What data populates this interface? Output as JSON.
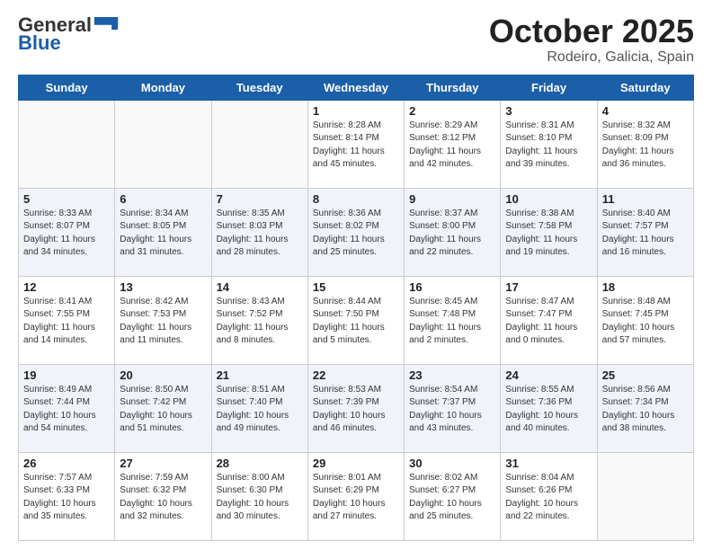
{
  "header": {
    "logo_line1": "General",
    "logo_line2": "Blue",
    "title": "October 2025",
    "subtitle": "Rodeiro, Galicia, Spain"
  },
  "days_of_week": [
    "Sunday",
    "Monday",
    "Tuesday",
    "Wednesday",
    "Thursday",
    "Friday",
    "Saturday"
  ],
  "weeks": [
    [
      {
        "day": "",
        "sunrise": "",
        "sunset": "",
        "daylight": ""
      },
      {
        "day": "",
        "sunrise": "",
        "sunset": "",
        "daylight": ""
      },
      {
        "day": "",
        "sunrise": "",
        "sunset": "",
        "daylight": ""
      },
      {
        "day": "1",
        "sunrise": "Sunrise: 8:28 AM",
        "sunset": "Sunset: 8:14 PM",
        "daylight": "Daylight: 11 hours and 45 minutes."
      },
      {
        "day": "2",
        "sunrise": "Sunrise: 8:29 AM",
        "sunset": "Sunset: 8:12 PM",
        "daylight": "Daylight: 11 hours and 42 minutes."
      },
      {
        "day": "3",
        "sunrise": "Sunrise: 8:31 AM",
        "sunset": "Sunset: 8:10 PM",
        "daylight": "Daylight: 11 hours and 39 minutes."
      },
      {
        "day": "4",
        "sunrise": "Sunrise: 8:32 AM",
        "sunset": "Sunset: 8:09 PM",
        "daylight": "Daylight: 11 hours and 36 minutes."
      }
    ],
    [
      {
        "day": "5",
        "sunrise": "Sunrise: 8:33 AM",
        "sunset": "Sunset: 8:07 PM",
        "daylight": "Daylight: 11 hours and 34 minutes."
      },
      {
        "day": "6",
        "sunrise": "Sunrise: 8:34 AM",
        "sunset": "Sunset: 8:05 PM",
        "daylight": "Daylight: 11 hours and 31 minutes."
      },
      {
        "day": "7",
        "sunrise": "Sunrise: 8:35 AM",
        "sunset": "Sunset: 8:03 PM",
        "daylight": "Daylight: 11 hours and 28 minutes."
      },
      {
        "day": "8",
        "sunrise": "Sunrise: 8:36 AM",
        "sunset": "Sunset: 8:02 PM",
        "daylight": "Daylight: 11 hours and 25 minutes."
      },
      {
        "day": "9",
        "sunrise": "Sunrise: 8:37 AM",
        "sunset": "Sunset: 8:00 PM",
        "daylight": "Daylight: 11 hours and 22 minutes."
      },
      {
        "day": "10",
        "sunrise": "Sunrise: 8:38 AM",
        "sunset": "Sunset: 7:58 PM",
        "daylight": "Daylight: 11 hours and 19 minutes."
      },
      {
        "day": "11",
        "sunrise": "Sunrise: 8:40 AM",
        "sunset": "Sunset: 7:57 PM",
        "daylight": "Daylight: 11 hours and 16 minutes."
      }
    ],
    [
      {
        "day": "12",
        "sunrise": "Sunrise: 8:41 AM",
        "sunset": "Sunset: 7:55 PM",
        "daylight": "Daylight: 11 hours and 14 minutes."
      },
      {
        "day": "13",
        "sunrise": "Sunrise: 8:42 AM",
        "sunset": "Sunset: 7:53 PM",
        "daylight": "Daylight: 11 hours and 11 minutes."
      },
      {
        "day": "14",
        "sunrise": "Sunrise: 8:43 AM",
        "sunset": "Sunset: 7:52 PM",
        "daylight": "Daylight: 11 hours and 8 minutes."
      },
      {
        "day": "15",
        "sunrise": "Sunrise: 8:44 AM",
        "sunset": "Sunset: 7:50 PM",
        "daylight": "Daylight: 11 hours and 5 minutes."
      },
      {
        "day": "16",
        "sunrise": "Sunrise: 8:45 AM",
        "sunset": "Sunset: 7:48 PM",
        "daylight": "Daylight: 11 hours and 2 minutes."
      },
      {
        "day": "17",
        "sunrise": "Sunrise: 8:47 AM",
        "sunset": "Sunset: 7:47 PM",
        "daylight": "Daylight: 11 hours and 0 minutes."
      },
      {
        "day": "18",
        "sunrise": "Sunrise: 8:48 AM",
        "sunset": "Sunset: 7:45 PM",
        "daylight": "Daylight: 10 hours and 57 minutes."
      }
    ],
    [
      {
        "day": "19",
        "sunrise": "Sunrise: 8:49 AM",
        "sunset": "Sunset: 7:44 PM",
        "daylight": "Daylight: 10 hours and 54 minutes."
      },
      {
        "day": "20",
        "sunrise": "Sunrise: 8:50 AM",
        "sunset": "Sunset: 7:42 PM",
        "daylight": "Daylight: 10 hours and 51 minutes."
      },
      {
        "day": "21",
        "sunrise": "Sunrise: 8:51 AM",
        "sunset": "Sunset: 7:40 PM",
        "daylight": "Daylight: 10 hours and 49 minutes."
      },
      {
        "day": "22",
        "sunrise": "Sunrise: 8:53 AM",
        "sunset": "Sunset: 7:39 PM",
        "daylight": "Daylight: 10 hours and 46 minutes."
      },
      {
        "day": "23",
        "sunrise": "Sunrise: 8:54 AM",
        "sunset": "Sunset: 7:37 PM",
        "daylight": "Daylight: 10 hours and 43 minutes."
      },
      {
        "day": "24",
        "sunrise": "Sunrise: 8:55 AM",
        "sunset": "Sunset: 7:36 PM",
        "daylight": "Daylight: 10 hours and 40 minutes."
      },
      {
        "day": "25",
        "sunrise": "Sunrise: 8:56 AM",
        "sunset": "Sunset: 7:34 PM",
        "daylight": "Daylight: 10 hours and 38 minutes."
      }
    ],
    [
      {
        "day": "26",
        "sunrise": "Sunrise: 7:57 AM",
        "sunset": "Sunset: 6:33 PM",
        "daylight": "Daylight: 10 hours and 35 minutes."
      },
      {
        "day": "27",
        "sunrise": "Sunrise: 7:59 AM",
        "sunset": "Sunset: 6:32 PM",
        "daylight": "Daylight: 10 hours and 32 minutes."
      },
      {
        "day": "28",
        "sunrise": "Sunrise: 8:00 AM",
        "sunset": "Sunset: 6:30 PM",
        "daylight": "Daylight: 10 hours and 30 minutes."
      },
      {
        "day": "29",
        "sunrise": "Sunrise: 8:01 AM",
        "sunset": "Sunset: 6:29 PM",
        "daylight": "Daylight: 10 hours and 27 minutes."
      },
      {
        "day": "30",
        "sunrise": "Sunrise: 8:02 AM",
        "sunset": "Sunset: 6:27 PM",
        "daylight": "Daylight: 10 hours and 25 minutes."
      },
      {
        "day": "31",
        "sunrise": "Sunrise: 8:04 AM",
        "sunset": "Sunset: 6:26 PM",
        "daylight": "Daylight: 10 hours and 22 minutes."
      },
      {
        "day": "",
        "sunrise": "",
        "sunset": "",
        "daylight": ""
      }
    ]
  ]
}
